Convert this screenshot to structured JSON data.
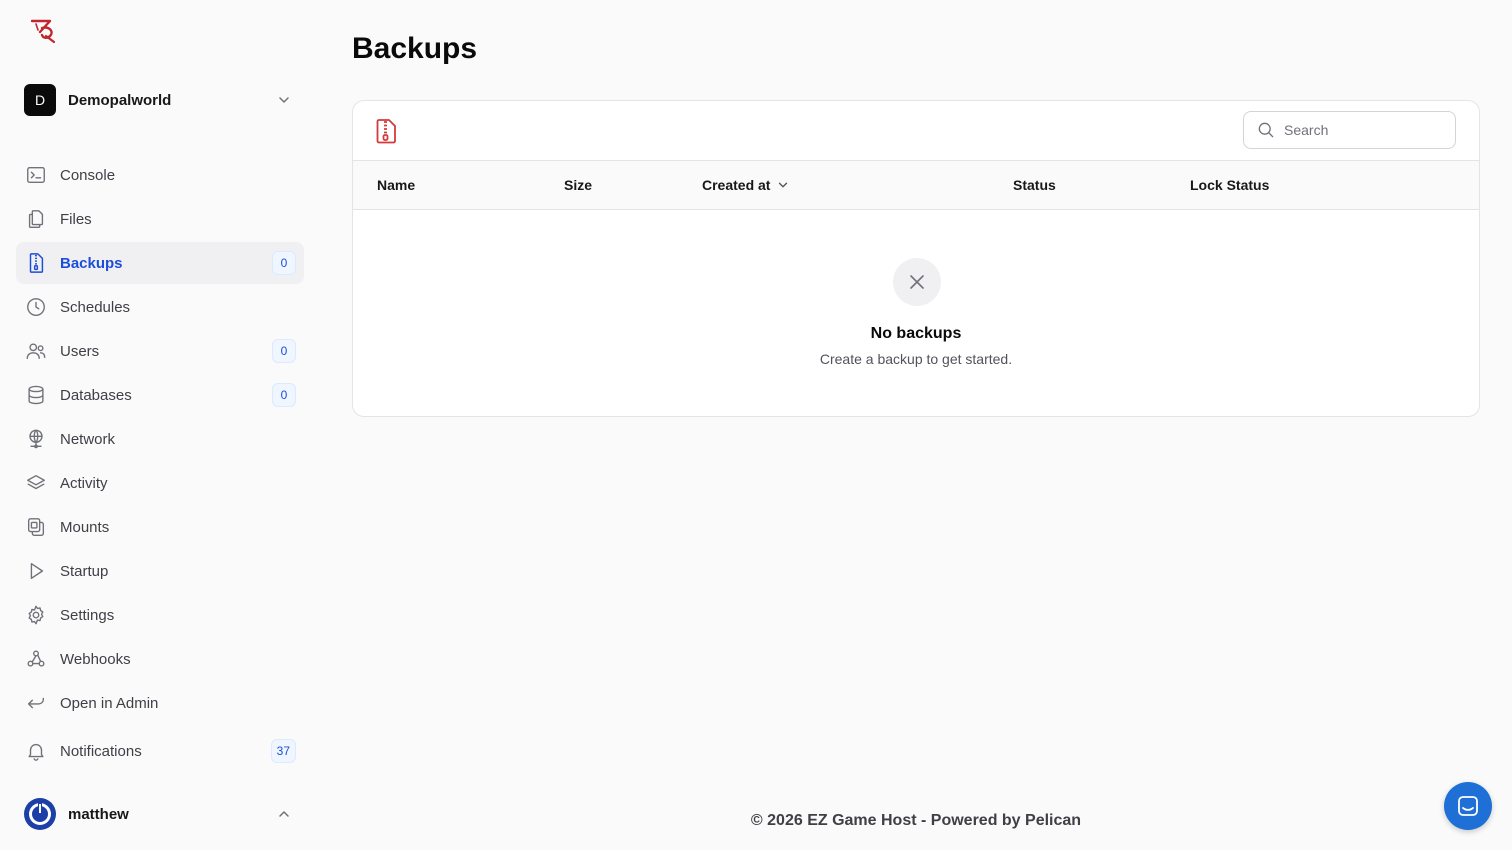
{
  "brand": {
    "accent": "#1d4ed8",
    "logo_color": "#c0262d"
  },
  "tenant": {
    "initial": "D",
    "name": "Demopalworld"
  },
  "sidebar": {
    "items": [
      {
        "label": "Console",
        "icon": "terminal-icon"
      },
      {
        "label": "Files",
        "icon": "files-icon"
      },
      {
        "label": "Backups",
        "icon": "archive-icon",
        "badge": "0",
        "active": true
      },
      {
        "label": "Schedules",
        "icon": "clock-icon"
      },
      {
        "label": "Users",
        "icon": "users-icon",
        "badge": "0"
      },
      {
        "label": "Databases",
        "icon": "database-icon",
        "badge": "0"
      },
      {
        "label": "Network",
        "icon": "network-icon"
      },
      {
        "label": "Activity",
        "icon": "stack-icon"
      },
      {
        "label": "Mounts",
        "icon": "mounts-icon"
      },
      {
        "label": "Startup",
        "icon": "play-icon"
      },
      {
        "label": "Settings",
        "icon": "gear-icon"
      },
      {
        "label": "Webhooks",
        "icon": "webhook-icon"
      },
      {
        "label": "Open in Admin",
        "icon": "return-arrow-icon"
      },
      {
        "label": "Notifications",
        "icon": "bell-icon",
        "badge": "37"
      }
    ]
  },
  "user": {
    "name": "matthew"
  },
  "main": {
    "title": "Backups",
    "search_placeholder": "Search",
    "columns": [
      "Name",
      "Size",
      "Created at",
      "Status",
      "Lock Status"
    ],
    "empty_title": "No backups",
    "empty_subtitle": "Create a backup to get started."
  },
  "footer": {
    "text": "© 2026 EZ Game Host - Powered by Pelican"
  }
}
